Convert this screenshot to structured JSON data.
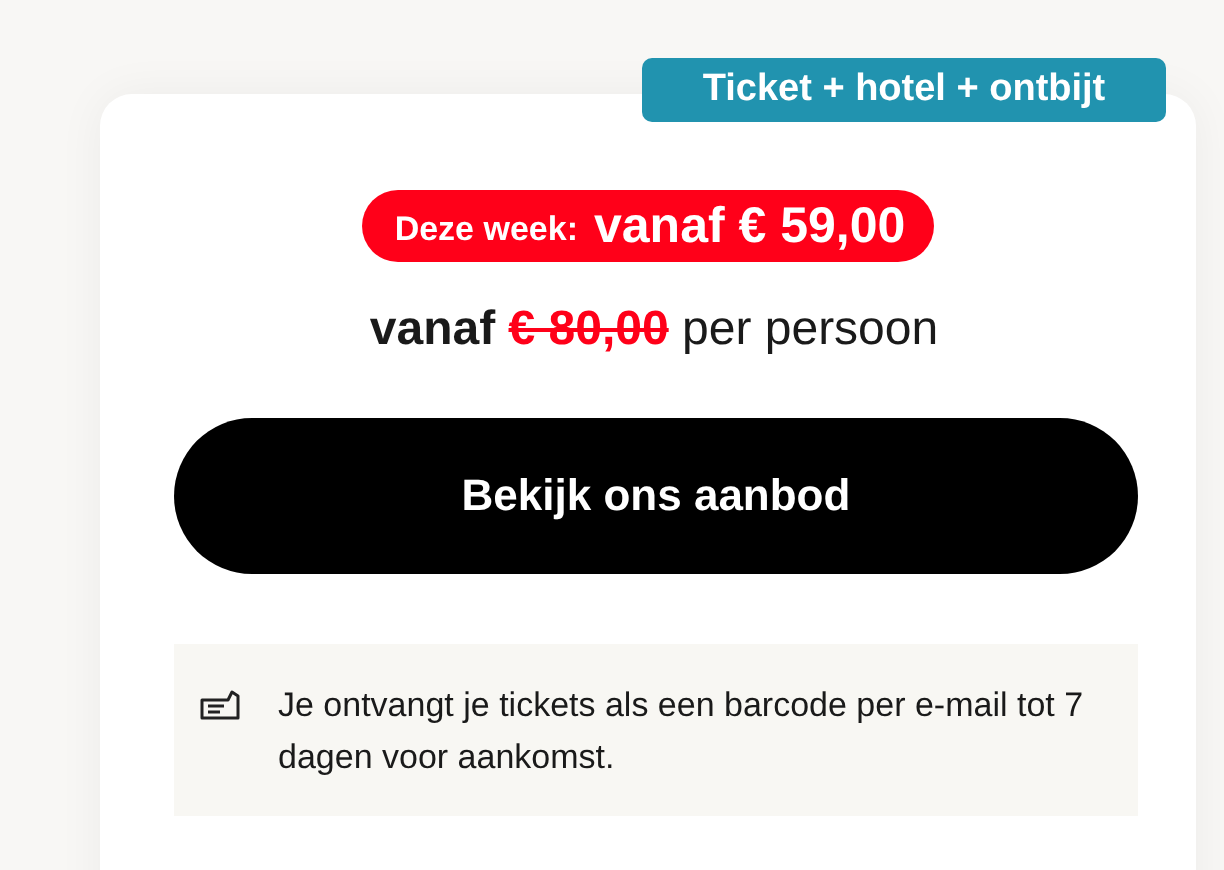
{
  "package_badge": "Ticket + hotel + ontbijt",
  "deal": {
    "label": "Deze week:",
    "price": "vanaf € 59,00"
  },
  "price_line": {
    "prefix": "vanaf",
    "old_price": "€ 80,00",
    "suffix": "per persoon"
  },
  "cta_button": "Bekijk ons aanbod",
  "info": {
    "text": "Je ontvangt je tickets als een barcode per e-mail tot 7 dagen voor aankomst."
  }
}
